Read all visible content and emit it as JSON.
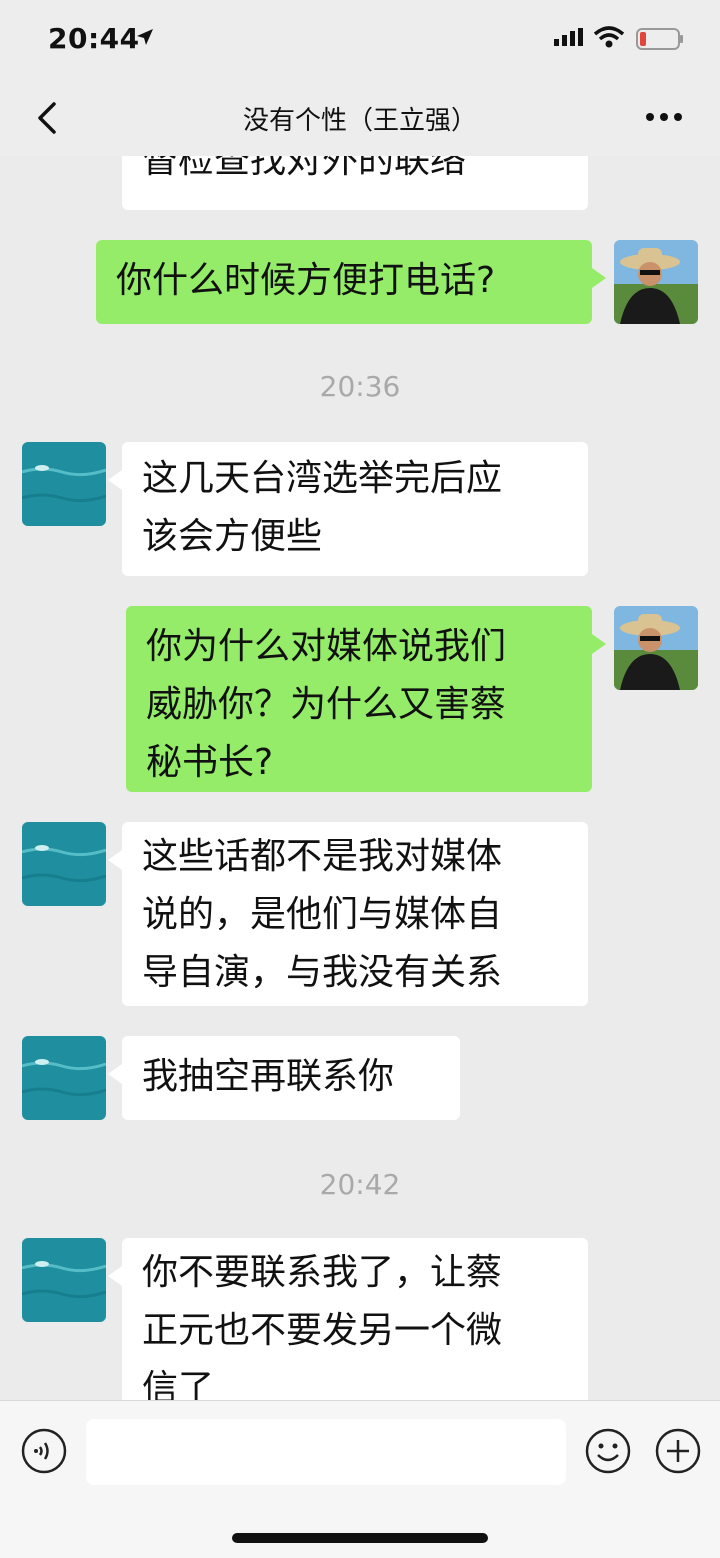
{
  "status_bar": {
    "time": "20:44"
  },
  "header": {
    "title": "没有个性（王立强）"
  },
  "messages": [
    {
      "type": "in",
      "lines": [
        "督检查找对外的联络"
      ]
    },
    {
      "type": "out",
      "lines": [
        "你什么时候方便打电话?"
      ]
    },
    {
      "type": "time",
      "text": "20:36"
    },
    {
      "type": "in",
      "lines": [
        "这几天台湾选举完后应",
        "该会方便些"
      ]
    },
    {
      "type": "out",
      "lines": [
        "你为什么对媒体说我们",
        "威胁你？为什么又害蔡",
        "秘书长?"
      ]
    },
    {
      "type": "in",
      "lines": [
        "这些话都不是我对媒体",
        "说的，是他们与媒体自",
        "导自演，与我没有关系"
      ]
    },
    {
      "type": "in",
      "lines": [
        "我抽空再联系你"
      ]
    },
    {
      "type": "time",
      "text": "20:42"
    },
    {
      "type": "in",
      "lines": [
        "你不要联系我了，让蔡",
        "正元也不要发另一个微",
        "信了"
      ]
    }
  ],
  "colors": {
    "outgoing_bubble": "#95ec69",
    "incoming_bubble": "#ffffff",
    "background": "#ebebeb"
  },
  "icons": [
    "location-arrow-icon",
    "signal-icon",
    "wifi-icon",
    "battery-icon",
    "back-chevron-icon",
    "more-icon",
    "voice-icon",
    "emoji-icon",
    "plus-icon"
  ]
}
